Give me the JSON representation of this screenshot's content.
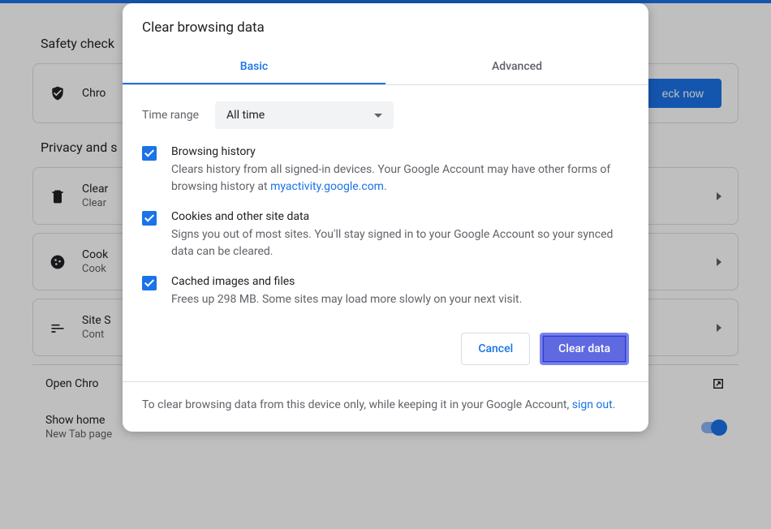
{
  "background": {
    "safety_check_title": "Safety check",
    "safety_check_text": "Chro",
    "check_now_button": "eck now",
    "privacy_section_title": "Privacy and s",
    "items": [
      {
        "title": "Clear",
        "sub": "Clear"
      },
      {
        "title": "Cook",
        "sub": "Cook"
      },
      {
        "title": "Site S",
        "sub": "Cont"
      }
    ],
    "open_chrome": "Open Chro",
    "show_home": "Show home",
    "new_tab": "New Tab page"
  },
  "dialog": {
    "title": "Clear browsing data",
    "tabs": {
      "basic": "Basic",
      "advanced": "Advanced"
    },
    "time_range_label": "Time range",
    "time_range_value": "All time",
    "options": [
      {
        "title": "Browsing history",
        "desc_pre": "Clears history from all signed-in devices. Your Google Account may have other forms of browsing history at ",
        "link": "myactivity.google.com",
        "desc_post": "."
      },
      {
        "title": "Cookies and other site data",
        "desc": "Signs you out of most sites. You'll stay signed in to your Google Account so your synced data can be cleared."
      },
      {
        "title": "Cached images and files",
        "desc": "Frees up 298 MB. Some sites may load more slowly on your next visit."
      }
    ],
    "cancel": "Cancel",
    "clear_data": "Clear data",
    "footer_pre": "To clear browsing data from this device only, while keeping it in your Google Account, ",
    "footer_link": "sign out",
    "footer_post": "."
  }
}
